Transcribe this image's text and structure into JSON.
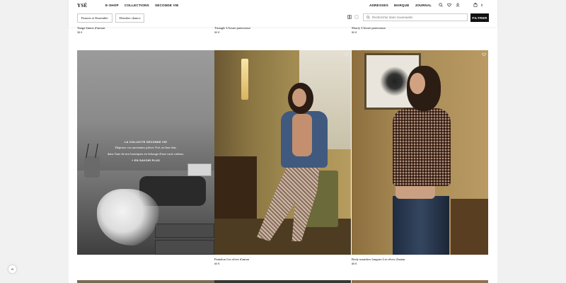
{
  "header": {
    "logo": "YSÉ",
    "nav_left": [
      "E-SHOP",
      "COLLECTIONS",
      "SECONDE VIE"
    ],
    "nav_right": [
      "ADRESSES",
      "MARQUE",
      "JOURNAL"
    ],
    "lang": "fr",
    "icons": [
      "search-icon",
      "heart-icon",
      "user-icon",
      "bag-icon"
    ]
  },
  "filters": {
    "chips": [
      "Parures et Ensemble",
      "Dernière chance"
    ],
    "search_placeholder": "Rechercher dans nouveautés",
    "filter_label": "FILTRER"
  },
  "top_row": [
    {
      "name": "Tanga Sœurs d'amour",
      "price": "35 €"
    },
    {
      "name": "Triangle L'heure paresseuse",
      "price": "50 €"
    },
    {
      "name": "Shorty L'heure paresseuse",
      "price": "50 €"
    }
  ],
  "promo": {
    "label": "LA COLLECTE SECONDE VIE",
    "desc_line1": "Déposez vos anciennes pièces Ysé, en bon état,",
    "desc_line2": "dans l'une de nos boutiques en échange d'une carte cadeau.",
    "link": "+  EN SAVOIR PLUS"
  },
  "grid_products": [
    {
      "name": "Pantalon Les rêves d'antan",
      "price": "60 €"
    },
    {
      "name": "Body manches longues Les rêves d'antan",
      "price": "85 €"
    }
  ],
  "colors": {
    "accent": "#111111",
    "page_bg": "#f1f1f1"
  }
}
